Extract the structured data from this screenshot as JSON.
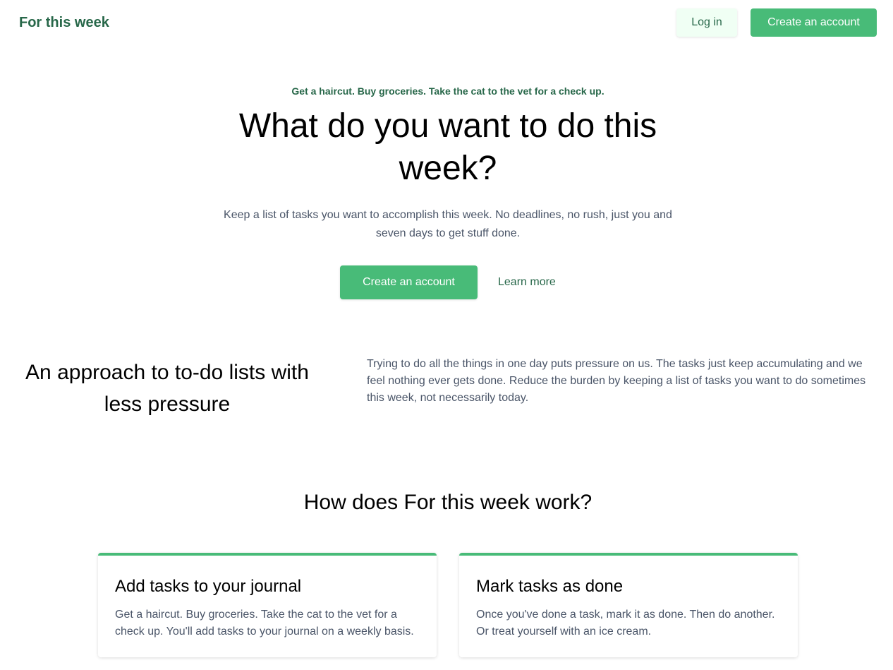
{
  "header": {
    "brand": "For this week",
    "login_label": "Log in",
    "create_account_label": "Create an account"
  },
  "hero": {
    "kicker": "Get a haircut. Buy groceries. Take the cat to the vet for a check up.",
    "title": "What do you want to do this week?",
    "text": "Keep a list of tasks you want to accomplish this week. No deadlines, no rush, just you and seven days to get stuff done.",
    "create_account_label": "Create an account",
    "learn_more_label": "Learn more"
  },
  "approach": {
    "title": "An approach to to-do lists with less pressure",
    "text": "Trying to do all the things in one day puts pressure on us. The tasks just keep accumulating and we feel nothing ever gets done. Reduce the burden by keeping a list of tasks you want to do sometimes this week, not necessarily today."
  },
  "how": {
    "title": "How does For this week work?",
    "cards": [
      {
        "title": "Add tasks to your journal",
        "text": "Get a haircut. Buy groceries. Take the cat to the vet for a check up. You'll add tasks to your journal on a weekly basis."
      },
      {
        "title": "Mark tasks as done",
        "text": "Once you've done a task, mark it as done. Then do another. Or treat yourself with an ice cream."
      }
    ]
  },
  "colors": {
    "brand_green": "#276749",
    "accent_green": "#48bb78",
    "light_green": "#f0fff4",
    "body_text": "#4a5568"
  }
}
